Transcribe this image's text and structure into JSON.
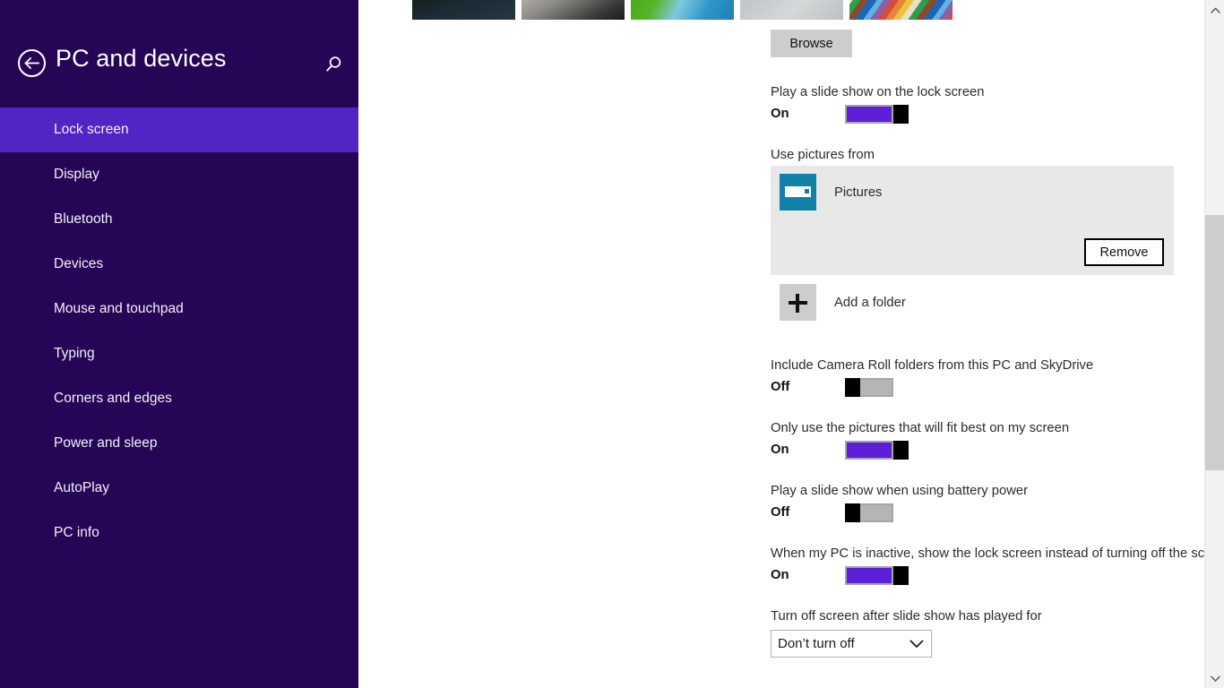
{
  "header": {
    "title": "PC and devices",
    "back_icon": "back-arrow-icon",
    "search_icon": "search-icon"
  },
  "sidebar": {
    "background_color": "#250656",
    "selected_color": "#5124c4",
    "items": [
      {
        "label": "Lock screen",
        "selected": true
      },
      {
        "label": "Display",
        "selected": false
      },
      {
        "label": "Bluetooth",
        "selected": false
      },
      {
        "label": "Devices",
        "selected": false
      },
      {
        "label": "Mouse and touchpad",
        "selected": false
      },
      {
        "label": "Typing",
        "selected": false
      },
      {
        "label": "Corners and edges",
        "selected": false
      },
      {
        "label": "Power and sleep",
        "selected": false
      },
      {
        "label": "AutoPlay",
        "selected": false
      },
      {
        "label": "PC info",
        "selected": false
      }
    ]
  },
  "main": {
    "thumbnails": [
      {
        "name": "thumbnail-dark-landscape"
      },
      {
        "name": "thumbnail-gray-texture"
      },
      {
        "name": "thumbnail-green-blue-pool"
      },
      {
        "name": "thumbnail-water-droplets"
      },
      {
        "name": "thumbnail-colored-pencils"
      }
    ],
    "browse_label": "Browse",
    "slideshow": {
      "label": "Play a slide show on the lock screen",
      "state": "On",
      "on": true
    },
    "use_pictures_from": {
      "label": "Use pictures from",
      "folder_name": "Pictures",
      "folder_icon": "pictures-folder-icon",
      "remove_label": "Remove",
      "add_folder_label": "Add a folder",
      "add_folder_icon": "plus-icon"
    },
    "settings": [
      {
        "label": "Include Camera Roll folders from this PC and SkyDrive",
        "state": "Off",
        "on": false
      },
      {
        "label": "Only use the pictures that will fit best on my screen",
        "state": "On",
        "on": true
      },
      {
        "label": "Play a slide show when using battery power",
        "state": "Off",
        "on": false
      },
      {
        "label": "When my PC is inactive, show the lock screen instead of turning off the screen",
        "state": "On",
        "on": true
      }
    ],
    "turn_off_screen": {
      "label": "Turn off screen after slide show has played for",
      "selected_option": "Don’t turn off",
      "chevron_icon": "chevron-down-icon"
    }
  },
  "scrollbar": {
    "up_icon": "chevron-up-icon",
    "down_icon": "chevron-down-icon"
  },
  "colors": {
    "accent_purple": "#5a1fd6",
    "sidebar_dark": "#250656",
    "sidebar_selected": "#5124c4",
    "folder_icon_teal": "#1281a8",
    "button_gray": "#cdcdcd"
  }
}
